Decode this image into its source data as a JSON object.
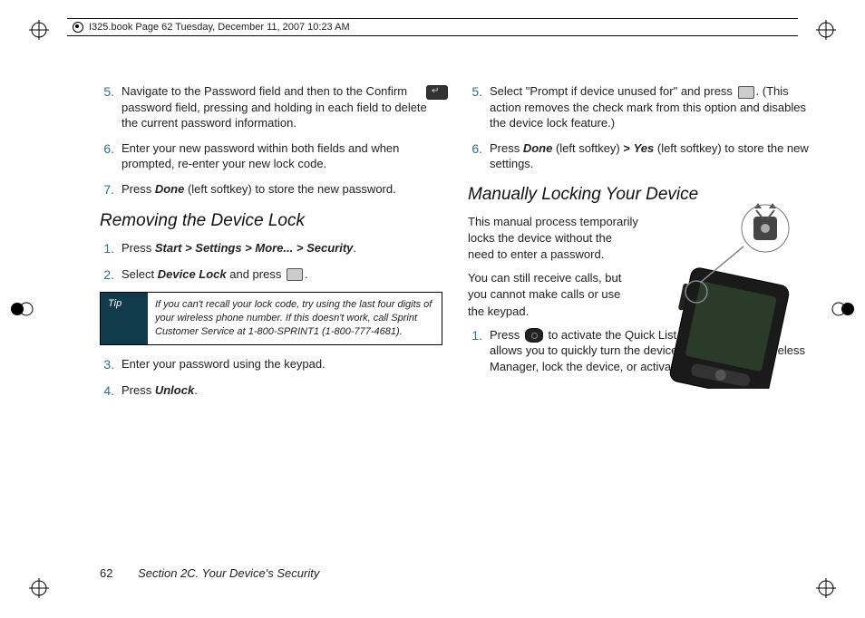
{
  "header": {
    "text": "I325.book  Page 62  Tuesday, December 11, 2007  10:23 AM"
  },
  "left": {
    "steps_a": [
      {
        "n": "5.",
        "text": "Navigate to the Password field and then to the Confirm password field, pressing and holding in each field to delete the current password information.",
        "icon": "back"
      },
      {
        "n": "6.",
        "text": "Enter your new password within both fields and when prompted, re-enter your new lock code."
      },
      {
        "n": "7.",
        "text_pre": "Press ",
        "kbd": "Done",
        "text_post": " (left softkey) to store the new password."
      }
    ],
    "heading": "Removing the Device Lock",
    "steps_b": [
      {
        "n": "1.",
        "text_pre": "Press ",
        "path": "Start > Settings > More... > Security",
        "text_post": "."
      },
      {
        "n": "2.",
        "text_pre": "Select ",
        "kbd": "Device Lock",
        "text_mid": " and press ",
        "icon": "square",
        "text_post": "."
      }
    ],
    "tip": {
      "label": "Tip",
      "body": "If you can't recall your lock code, try using the last four digits of your wireless phone number. If this doesn't work, call Sprint Customer Service at 1-800-SPRINT1 (1-800-777-4681)."
    },
    "steps_c": [
      {
        "n": "3.",
        "text": "Enter your password using the keypad."
      },
      {
        "n": "4.",
        "text_pre": "Press ",
        "kbd": "Unlock",
        "text_post": "."
      }
    ]
  },
  "right": {
    "steps_a": [
      {
        "n": "5.",
        "text_pre": "Select \"Prompt if device unused for\" and press ",
        "icon": "square",
        "text_post": ". (This action removes the check mark from this option and disables the device lock feature.)"
      },
      {
        "n": "6.",
        "text_pre": "Press ",
        "kbd1": "Done",
        "mid1": " (left softkey) ",
        "gt": ">",
        "mid2": " ",
        "kbd2": "Yes",
        "text_post": " (left softkey) to store the new settings."
      }
    ],
    "heading": "Manually Locking Your Device",
    "para1": "This manual process temporarily locks the device without the need to enter a password.",
    "para2": "You can still receive calls, but you cannot make calls or use the keypad.",
    "steps_b": [
      {
        "n": "1.",
        "text_pre": "Press ",
        "icon": "round",
        "text_post": " to activate the Quick List menu. (This menu allows you to quickly turn the device off, access the Wireless Manager, lock the device, or activate sound profiles.)"
      }
    ]
  },
  "footer": {
    "page": "62",
    "section": "Section 2C. Your Device's Security"
  }
}
